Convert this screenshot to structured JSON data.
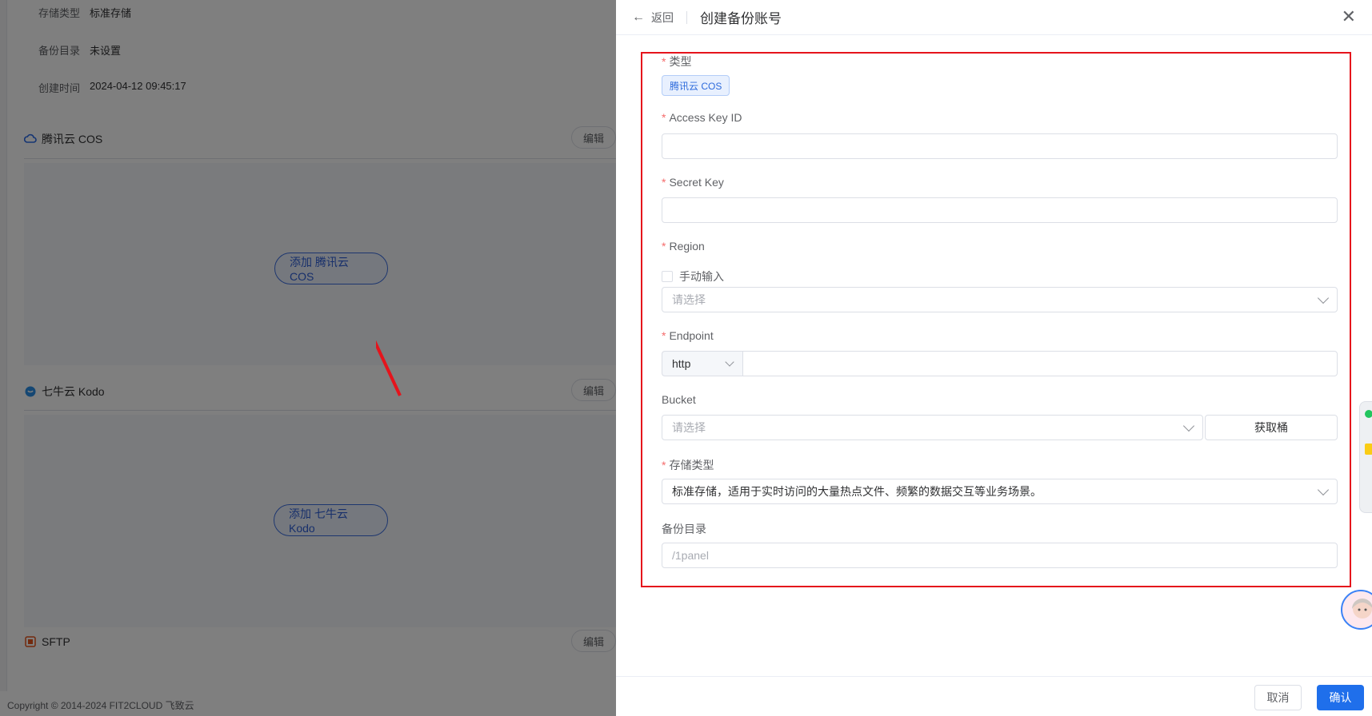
{
  "background": {
    "info_rows": [
      {
        "key": "存储类型",
        "value": "标准存储"
      },
      {
        "key": "备份目录",
        "value": "未设置"
      },
      {
        "key": "创建时间",
        "value": "2024-04-12 09:45:17"
      }
    ],
    "sections": [
      {
        "title": "腾讯云 COS",
        "edit": "编辑",
        "add_label": "添加 腾讯云 COS"
      },
      {
        "title": "七牛云 Kodo",
        "edit": "编辑",
        "add_label": "添加 七牛云 Kodo"
      },
      {
        "title": "SFTP",
        "edit": "编辑"
      }
    ],
    "copyright": "Copyright © 2014-2024 FIT2CLOUD 飞致云"
  },
  "drawer": {
    "back_label": "返回",
    "title": "创建备份账号",
    "form": {
      "type": {
        "label": "类型",
        "tag": "腾讯云 COS"
      },
      "access_key": {
        "label": "Access Key ID",
        "value": ""
      },
      "secret_key": {
        "label": "Secret Key",
        "value": ""
      },
      "region": {
        "label": "Region",
        "manual_label": "手动输入",
        "placeholder": "请选择"
      },
      "endpoint": {
        "label": "Endpoint",
        "protocol": "http",
        "value": ""
      },
      "bucket": {
        "label": "Bucket",
        "placeholder": "请选择",
        "fetch_button": "获取桶"
      },
      "storage_type": {
        "label": "存储类型",
        "value": "标准存储，适用于实时访问的大量热点文件、频繁的数据交互等业务场景。"
      },
      "backup_dir": {
        "label": "备份目录",
        "placeholder": "/1panel"
      }
    },
    "footer": {
      "cancel": "取消",
      "confirm": "确认"
    }
  },
  "colors": {
    "primary": "#1f6feb",
    "annotation_red": "#e5141c",
    "required_star": "#f56c6c"
  }
}
